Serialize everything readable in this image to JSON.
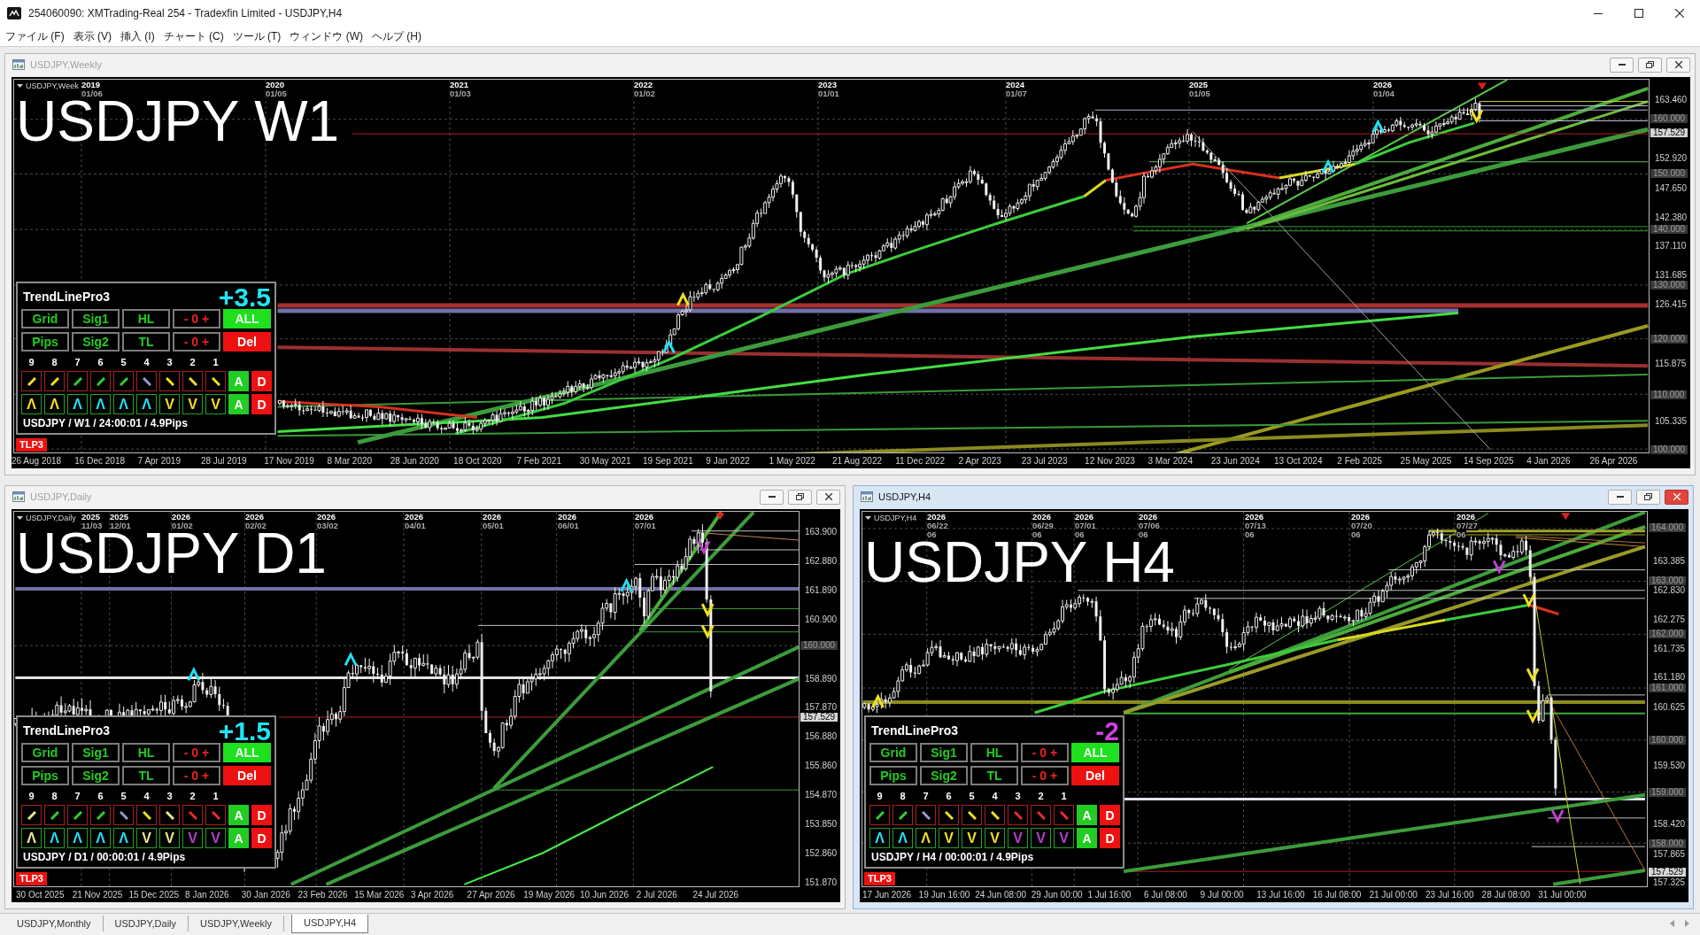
{
  "window": {
    "title": "254060090: XMTrading-Real 254 - Tradexfin Limited - USDJPY,H4"
  },
  "menu": [
    "ファイル (F)",
    "表示 (V)",
    "挿入 (I)",
    "チャート (C)",
    "ツール (T)",
    "ウィンドウ (W)",
    "ヘルプ (H)"
  ],
  "charts": [
    {
      "title": "USDJPY,Weekly",
      "active": false,
      "symbol_label": "USDJPY,Week",
      "big_label": "USDJPY W1",
      "time_labels": [
        {
          "year": "2019",
          "date": "01/06"
        },
        {
          "year": "2020",
          "date": "01/05"
        },
        {
          "year": "2021",
          "date": "01/03"
        },
        {
          "year": "2022",
          "date": "01/02"
        },
        {
          "year": "2023",
          "date": "01/01"
        },
        {
          "year": "2024",
          "date": "01/07"
        },
        {
          "year": "2025",
          "date": "01/05"
        },
        {
          "year": "2026",
          "date": "01/04"
        }
      ],
      "price_labels": [
        {
          "text": "163.460",
          "kind": "tick"
        },
        {
          "text": "160.000",
          "kind": "level"
        },
        {
          "text": "157.529",
          "kind": "current"
        },
        {
          "text": "152.920",
          "kind": "tick"
        },
        {
          "text": "150.000",
          "kind": "level"
        },
        {
          "text": "147.650",
          "kind": "tick"
        },
        {
          "text": "142.380",
          "kind": "tick"
        },
        {
          "text": "140.000",
          "kind": "level"
        },
        {
          "text": "137.110",
          "kind": "tick"
        },
        {
          "text": "131.685",
          "kind": "tick"
        },
        {
          "text": "130.000",
          "kind": "level"
        },
        {
          "text": "126.415",
          "kind": "tick"
        },
        {
          "text": "120.000",
          "kind": "level"
        },
        {
          "text": "115.875",
          "kind": "tick"
        },
        {
          "text": "110.000",
          "kind": "level"
        },
        {
          "text": "105.335",
          "kind": "tick"
        },
        {
          "text": "100.000",
          "kind": "level"
        }
      ],
      "date_labels": [
        "26 Aug 2018",
        "16 Dec 2018",
        "7 Apr 2019",
        "28 Jul 2019",
        "17 Nov 2019",
        "8 Mar 2020",
        "28 Jun 2020",
        "18 Oct 2020",
        "7 Feb 2021",
        "30 May 2021",
        "19 Sep 2021",
        "9 Jan 2022",
        "1 May 2022",
        "21 Aug 2022",
        "11 Dec 2022",
        "2 Apr 2023",
        "23 Jul 2023",
        "12 Nov 2023",
        "3 Mar 2024",
        "23 Jun 2024",
        "13 Oct 2024",
        "2 Feb 2025",
        "25 May 2025",
        "14 Sep 2025",
        "4 Jan 2026",
        "26 Apr 2026"
      ],
      "panel": {
        "title": "TrendLinePro3",
        "score": {
          "text": "+3.5",
          "color": "#22e4f4"
        },
        "buttons": [
          {
            "label": "Grid",
            "kind": "toggle"
          },
          {
            "label": "Sig1",
            "kind": "toggle"
          },
          {
            "label": "HL",
            "kind": "toggle"
          },
          {
            "label": "- 0 +",
            "kind": "stepper"
          },
          {
            "label": "ALL",
            "kind": "all"
          },
          {
            "label": "Pips",
            "kind": "toggle"
          },
          {
            "label": "Sig2",
            "kind": "toggle"
          },
          {
            "label": "TL",
            "kind": "toggle"
          },
          {
            "label": "- 0 +",
            "kind": "stepper"
          },
          {
            "label": "Del",
            "kind": "delete"
          }
        ],
        "numbers": [
          "9",
          "8",
          "7",
          "6",
          "5",
          "4",
          "3",
          "2",
          "1"
        ],
        "trend_cells": [
          {
            "kind": "rising",
            "color": "#f0e020"
          },
          {
            "kind": "rising",
            "color": "#f0e020"
          },
          {
            "kind": "rising",
            "color": "#30d030"
          },
          {
            "kind": "rising",
            "color": "#30d030"
          },
          {
            "kind": "rising",
            "color": "#30d030"
          },
          {
            "kind": "falling",
            "color": "#9a9ad0"
          },
          {
            "kind": "falling",
            "color": "#f0e020"
          },
          {
            "kind": "falling",
            "color": "#f0e020"
          },
          {
            "kind": "falling",
            "color": "#f0e020"
          }
        ],
        "trend_actions": [
          {
            "label": "A",
            "kind": "add"
          },
          {
            "label": "D",
            "kind": "delete"
          }
        ],
        "signal_cells": [
          {
            "text": "Λ",
            "color": "#f0e020"
          },
          {
            "text": "Λ",
            "color": "#f0e020"
          },
          {
            "text": "Λ",
            "color": "#22e0f0"
          },
          {
            "text": "Λ",
            "color": "#22e0f0"
          },
          {
            "text": "Λ",
            "color": "#22e0f0"
          },
          {
            "text": "Λ",
            "color": "#22e0f0"
          },
          {
            "text": "V",
            "color": "#f0e020"
          },
          {
            "text": "V",
            "color": "#f0e020"
          },
          {
            "text": "V",
            "color": "#f0e020"
          }
        ],
        "signal_actions": [
          {
            "label": "A",
            "kind": "add"
          },
          {
            "label": "D",
            "kind": "delete"
          }
        ],
        "footer": "USDJPY / W1 / 24:00:01 / 4.9Pips"
      },
      "badge": "TLP3"
    },
    {
      "title": "USDJPY,Daily",
      "active": false,
      "symbol_label": "USDJPY,Daily",
      "big_label": "USDJPY D1",
      "time_labels": [
        {
          "year": "2025",
          "date": "11/03"
        },
        {
          "year": "2025",
          "date": "12/01"
        },
        {
          "year": "2026",
          "date": "01/02"
        },
        {
          "year": "2026",
          "date": "02/02"
        },
        {
          "year": "2026",
          "date": "03/02"
        },
        {
          "year": "2026",
          "date": "04/01"
        },
        {
          "year": "2026",
          "date": "05/01"
        },
        {
          "year": "2026",
          "date": "06/01"
        },
        {
          "year": "2026",
          "date": "07/01"
        }
      ],
      "price_labels": [
        {
          "text": "163.900",
          "kind": "tick"
        },
        {
          "text": "162.880",
          "kind": "tick"
        },
        {
          "text": "161.890",
          "kind": "tick"
        },
        {
          "text": "160.900",
          "kind": "tick"
        },
        {
          "text": "160.000",
          "kind": "level"
        },
        {
          "text": "158.890",
          "kind": "tick"
        },
        {
          "text": "157.870",
          "kind": "tick"
        },
        {
          "text": "157.529",
          "kind": "current"
        },
        {
          "text": "156.880",
          "kind": "tick"
        },
        {
          "text": "155.860",
          "kind": "tick"
        },
        {
          "text": "154.870",
          "kind": "tick"
        },
        {
          "text": "153.850",
          "kind": "tick"
        },
        {
          "text": "152.860",
          "kind": "tick"
        },
        {
          "text": "151.870",
          "kind": "tick"
        }
      ],
      "date_labels": [
        "30 Oct 2025",
        "21 Nov 2025",
        "15 Dec 2025",
        "8 Jan 2026",
        "30 Jan 2026",
        "23 Feb 2026",
        "15 Mar 2026",
        "3 Apr 2026",
        "27 Apr 2026",
        "19 May 2026",
        "10 Jun 2026",
        "2 Jul 2026",
        "24 Jul 2026"
      ],
      "panel": {
        "title": "TrendLinePro3",
        "score": {
          "text": "+1.5",
          "color": "#22e4f4"
        },
        "buttons": [
          {
            "label": "Grid",
            "kind": "toggle"
          },
          {
            "label": "Sig1",
            "kind": "toggle"
          },
          {
            "label": "HL",
            "kind": "toggle"
          },
          {
            "label": "- 0 +",
            "kind": "stepper"
          },
          {
            "label": "ALL",
            "kind": "all"
          },
          {
            "label": "Pips",
            "kind": "toggle"
          },
          {
            "label": "Sig2",
            "kind": "toggle"
          },
          {
            "label": "TL",
            "kind": "toggle"
          },
          {
            "label": "- 0 +",
            "kind": "stepper"
          },
          {
            "label": "Del",
            "kind": "delete"
          }
        ],
        "numbers": [
          "9",
          "8",
          "7",
          "6",
          "5",
          "4",
          "3",
          "2",
          "1"
        ],
        "trend_cells": [
          {
            "kind": "rising",
            "color": "#e8e890"
          },
          {
            "kind": "rising",
            "color": "#30d030"
          },
          {
            "kind": "rising",
            "color": "#30d030"
          },
          {
            "kind": "rising",
            "color": "#30d030"
          },
          {
            "kind": "falling",
            "color": "#9a9ad0"
          },
          {
            "kind": "falling",
            "color": "#f0e020"
          },
          {
            "kind": "falling",
            "color": "#e8e890"
          },
          {
            "kind": "falling",
            "color": "#ee2a2a"
          },
          {
            "kind": "falling",
            "color": "#ee2a2a"
          }
        ],
        "trend_actions": [
          {
            "label": "A",
            "kind": "add"
          },
          {
            "label": "D",
            "kind": "delete"
          }
        ],
        "signal_cells": [
          {
            "text": "Λ",
            "color": "#e8e890"
          },
          {
            "text": "Λ",
            "color": "#22e0f0"
          },
          {
            "text": "Λ",
            "color": "#22e0f0"
          },
          {
            "text": "Λ",
            "color": "#22e0f0"
          },
          {
            "text": "Λ",
            "color": "#22e0f0"
          },
          {
            "text": "V",
            "color": "#e8e890"
          },
          {
            "text": "V",
            "color": "#e8e890"
          },
          {
            "text": "V",
            "color": "#b040c8"
          },
          {
            "text": "V",
            "color": "#b040c8"
          }
        ],
        "signal_actions": [
          {
            "label": "A",
            "kind": "add"
          },
          {
            "label": "D",
            "kind": "delete"
          }
        ],
        "footer": "USDJPY / D1 / 00:00:01 / 4.9Pips"
      },
      "badge": "TLP3"
    },
    {
      "title": "USDJPY,H4",
      "active": true,
      "symbol_label": "USDJPY,H4",
      "big_label": "USDJPY H4",
      "time_labels": [
        {
          "year": "2026",
          "date": "06/22",
          "hour": "06"
        },
        {
          "year": "2026",
          "date": "06/29",
          "hour": "06"
        },
        {
          "year": "2026",
          "date": "07/01",
          "hour": "06"
        },
        {
          "year": "2026",
          "date": "07/06",
          "hour": "06"
        },
        {
          "year": "2026",
          "date": "07/13",
          "hour": "06"
        },
        {
          "year": "2026",
          "date": "07/20",
          "hour": "06"
        },
        {
          "year": "2026",
          "date": "07/27",
          "hour": "06"
        }
      ],
      "price_labels": [
        {
          "text": "164.000",
          "kind": "level"
        },
        {
          "text": "163.385",
          "kind": "tick"
        },
        {
          "text": "163.000",
          "kind": "level"
        },
        {
          "text": "162.830",
          "kind": "tick"
        },
        {
          "text": "162.275",
          "kind": "tick"
        },
        {
          "text": "162.000",
          "kind": "level"
        },
        {
          "text": "161.735",
          "kind": "tick"
        },
        {
          "text": "161.180",
          "kind": "tick"
        },
        {
          "text": "161.000",
          "kind": "level"
        },
        {
          "text": "160.625",
          "kind": "tick"
        },
        {
          "text": "160.000",
          "kind": "level"
        },
        {
          "text": "159.530",
          "kind": "tick"
        },
        {
          "text": "159.000",
          "kind": "level"
        },
        {
          "text": "158.420",
          "kind": "tick"
        },
        {
          "text": "158.000",
          "kind": "level"
        },
        {
          "text": "157.865",
          "kind": "tick"
        },
        {
          "text": "157.529",
          "kind": "current"
        },
        {
          "text": "157.325",
          "kind": "tick"
        }
      ],
      "date_labels": [
        "17 Jun 2026",
        "19 Jun 16:00",
        "24 Jun 08:00",
        "29 Jun 00:00",
        "1 Jul 16:00",
        "6 Jul 08:00",
        "9 Jul 00:00",
        "13 Jul 16:00",
        "16 Jul 08:00",
        "21 Jul 00:00",
        "23 Jul 16:00",
        "28 Jul 08:00",
        "31 Jul 00:00"
      ],
      "panel": {
        "title": "TrendLinePro3",
        "score": {
          "text": "-2",
          "color": "#d040e0"
        },
        "buttons": [
          {
            "label": "Grid",
            "kind": "toggle"
          },
          {
            "label": "Sig1",
            "kind": "toggle"
          },
          {
            "label": "HL",
            "kind": "toggle"
          },
          {
            "label": "- 0 +",
            "kind": "stepper"
          },
          {
            "label": "ALL",
            "kind": "all"
          },
          {
            "label": "Pips",
            "kind": "toggle"
          },
          {
            "label": "Sig2",
            "kind": "toggle"
          },
          {
            "label": "TL",
            "kind": "toggle"
          },
          {
            "label": "- 0 +",
            "kind": "stepper"
          },
          {
            "label": "Del",
            "kind": "delete"
          }
        ],
        "numbers": [
          "9",
          "8",
          "7",
          "6",
          "5",
          "4",
          "3",
          "2",
          "1"
        ],
        "trend_cells": [
          {
            "kind": "rising",
            "color": "#30d030"
          },
          {
            "kind": "rising",
            "color": "#30d030"
          },
          {
            "kind": "falling",
            "color": "#9a9ad0"
          },
          {
            "kind": "falling",
            "color": "#f0e020"
          },
          {
            "kind": "falling",
            "color": "#f0e020"
          },
          {
            "kind": "falling",
            "color": "#f0e020"
          },
          {
            "kind": "falling",
            "color": "#ee2a2a"
          },
          {
            "kind": "falling",
            "color": "#ee2a2a"
          },
          {
            "kind": "falling",
            "color": "#ee2a2a"
          }
        ],
        "trend_actions": [
          {
            "label": "A",
            "kind": "add"
          },
          {
            "label": "D",
            "kind": "delete"
          }
        ],
        "signal_cells": [
          {
            "text": "Λ",
            "color": "#22e0f0"
          },
          {
            "text": "Λ",
            "color": "#22e0f0"
          },
          {
            "text": "Λ",
            "color": "#f0e020"
          },
          {
            "text": "V",
            "color": "#f0e020"
          },
          {
            "text": "V",
            "color": "#f0e020"
          },
          {
            "text": "V",
            "color": "#f0e020"
          },
          {
            "text": "V",
            "color": "#b040c8"
          },
          {
            "text": "V",
            "color": "#b040c8"
          },
          {
            "text": "V",
            "color": "#b040c8"
          }
        ],
        "signal_actions": [
          {
            "label": "A",
            "kind": "add"
          },
          {
            "label": "D",
            "kind": "delete"
          }
        ],
        "footer": "USDJPY / H4 / 00:00:01 / 4.9Pips"
      },
      "badge": "TLP3"
    }
  ],
  "tabs": [
    {
      "label": "USDJPY,Monthly",
      "selected": false
    },
    {
      "label": "USDJPY,Daily",
      "selected": false
    },
    {
      "label": "USDJPY,Weekly",
      "selected": false
    },
    {
      "label": "USDJPY,H4",
      "selected": true
    }
  ]
}
